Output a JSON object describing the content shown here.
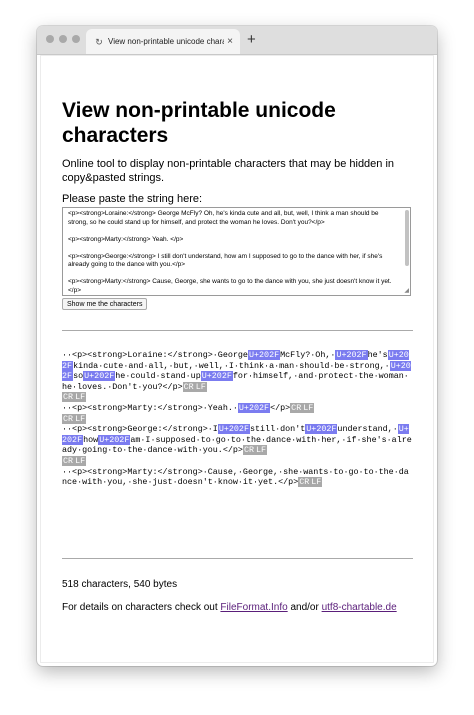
{
  "browser": {
    "tab_title": "View non-printable unicode chara",
    "close_glyph": "×",
    "new_tab_glyph": "+"
  },
  "page": {
    "title": "View non-printable unicode characters",
    "intro": "Online tool to display non-printable characters that may be hidden in copy&pasted strings.",
    "paste_label": "Please paste the string here:",
    "textarea_value": "<p><strong>Loraine:</strong> George McFly? Oh, he's kinda cute and all, but, well, I think a man should be strong, so he could stand up for himself, and protect the woman he loves. Don't you?</p>\n\n<p><strong>Marty:</strong> Yeah. </p>\n\n<p><strong>George:</strong> I still don't understand, how am I supposed to go to the dance with her, if she's already going to the dance with you.</p>\n\n<p><strong>Marty:</strong> Cause, George, she wants to go to the dance with you, she just doesn't know it yet.</p>",
    "show_button": "Show me the characters",
    "output_lines": [
      [
        {
          "t": "··<p><strong>Loraine:</strong>·George"
        },
        {
          "t": "U+202F",
          "k": "u"
        },
        {
          "t": "McFly?·Oh,·"
        },
        {
          "t": "U+202F",
          "k": "u"
        },
        {
          "t": "he's"
        },
        {
          "t": "U+202F",
          "k": "u"
        },
        {
          "t": "kinda·cute·and·all,·but,·well,·I·think·a·man·should·be·strong,·"
        },
        {
          "t": "U+202F",
          "k": "u"
        },
        {
          "t": "so"
        },
        {
          "t": "U+202F",
          "k": "u"
        },
        {
          "t": "he·could·stand·up"
        },
        {
          "t": "U+202F",
          "k": "u"
        },
        {
          "t": "for·himself,·and·protect·the·woman·he·loves.·Don't·you?</p>"
        },
        {
          "t": "CR",
          "k": "c"
        },
        {
          "t": "LF",
          "k": "c"
        }
      ],
      [
        {
          "t": "CR",
          "k": "c"
        },
        {
          "t": "LF",
          "k": "c"
        }
      ],
      [
        {
          "t": "··<p><strong>Marty:</strong>·Yeah.·"
        },
        {
          "t": "U+202F",
          "k": "u"
        },
        {
          "t": "</p>"
        },
        {
          "t": "CR",
          "k": "c"
        },
        {
          "t": "LF",
          "k": "c"
        }
      ],
      [
        {
          "t": "CR",
          "k": "c"
        },
        {
          "t": "LF",
          "k": "c"
        }
      ],
      [
        {
          "t": "··<p><strong>George:</strong>·I"
        },
        {
          "t": "U+202F",
          "k": "u"
        },
        {
          "t": "still·don't"
        },
        {
          "t": "U+202F",
          "k": "u"
        },
        {
          "t": "understand,·"
        },
        {
          "t": "U+202F",
          "k": "u"
        },
        {
          "t": "how"
        },
        {
          "t": "U+202F",
          "k": "u"
        },
        {
          "t": "am·I·supposed·to·go·to·the·dance·with·her,·if·she's·already·going·to·the·dance·with·you.</p>"
        },
        {
          "t": "CR",
          "k": "c"
        },
        {
          "t": "LF",
          "k": "c"
        }
      ],
      [
        {
          "t": "CR",
          "k": "c"
        },
        {
          "t": "LF",
          "k": "c"
        }
      ],
      [
        {
          "t": "··<p><strong>Marty:</strong>·Cause,·George,·she·wants·to·go·to·the·dance·with·you,·she·just·doesn't·know·it·yet.</p>"
        },
        {
          "t": "CR",
          "k": "c"
        },
        {
          "t": "LF",
          "k": "c"
        }
      ]
    ],
    "count_text": "518 characters, 540 bytes",
    "details_prefix": "For details on characters check out ",
    "details_link1": "FileFormat.Info",
    "details_mid": " and/or ",
    "details_link2": "utf8-chartable.de"
  }
}
